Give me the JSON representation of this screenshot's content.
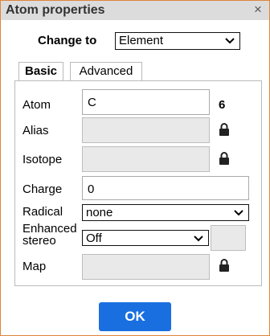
{
  "dialog": {
    "title": "Atom properties",
    "close_glyph": "×"
  },
  "change_to": {
    "label": "Change to",
    "selected": "Element"
  },
  "tabs": [
    {
      "label": "Basic",
      "active": true
    },
    {
      "label": "Advanced",
      "active": false
    }
  ],
  "basic": {
    "atom": {
      "label": "Atom",
      "value": "C",
      "count": "6"
    },
    "alias": {
      "label": "Alias",
      "value": ""
    },
    "isotope": {
      "label": "Isotope",
      "value": ""
    },
    "charge": {
      "label": "Charge",
      "value": "0"
    },
    "radical": {
      "label": "Radical",
      "selected": "none"
    },
    "enhanced_stereo": {
      "label_line1": "Enhanced",
      "label_line2": "stereo",
      "selected": "Off",
      "extra": ""
    },
    "map": {
      "label": "Map",
      "value": ""
    }
  },
  "ok_label": "OK",
  "icons": {
    "lock": "lock-icon",
    "dropdown": "chevron-down-icon",
    "close": "close-icon"
  },
  "colors": {
    "accent": "#1a6fe0",
    "dialog_border": "#e0843a",
    "titlebar": "#dcdcdc",
    "disabled_field": "#e9e9e9"
  }
}
